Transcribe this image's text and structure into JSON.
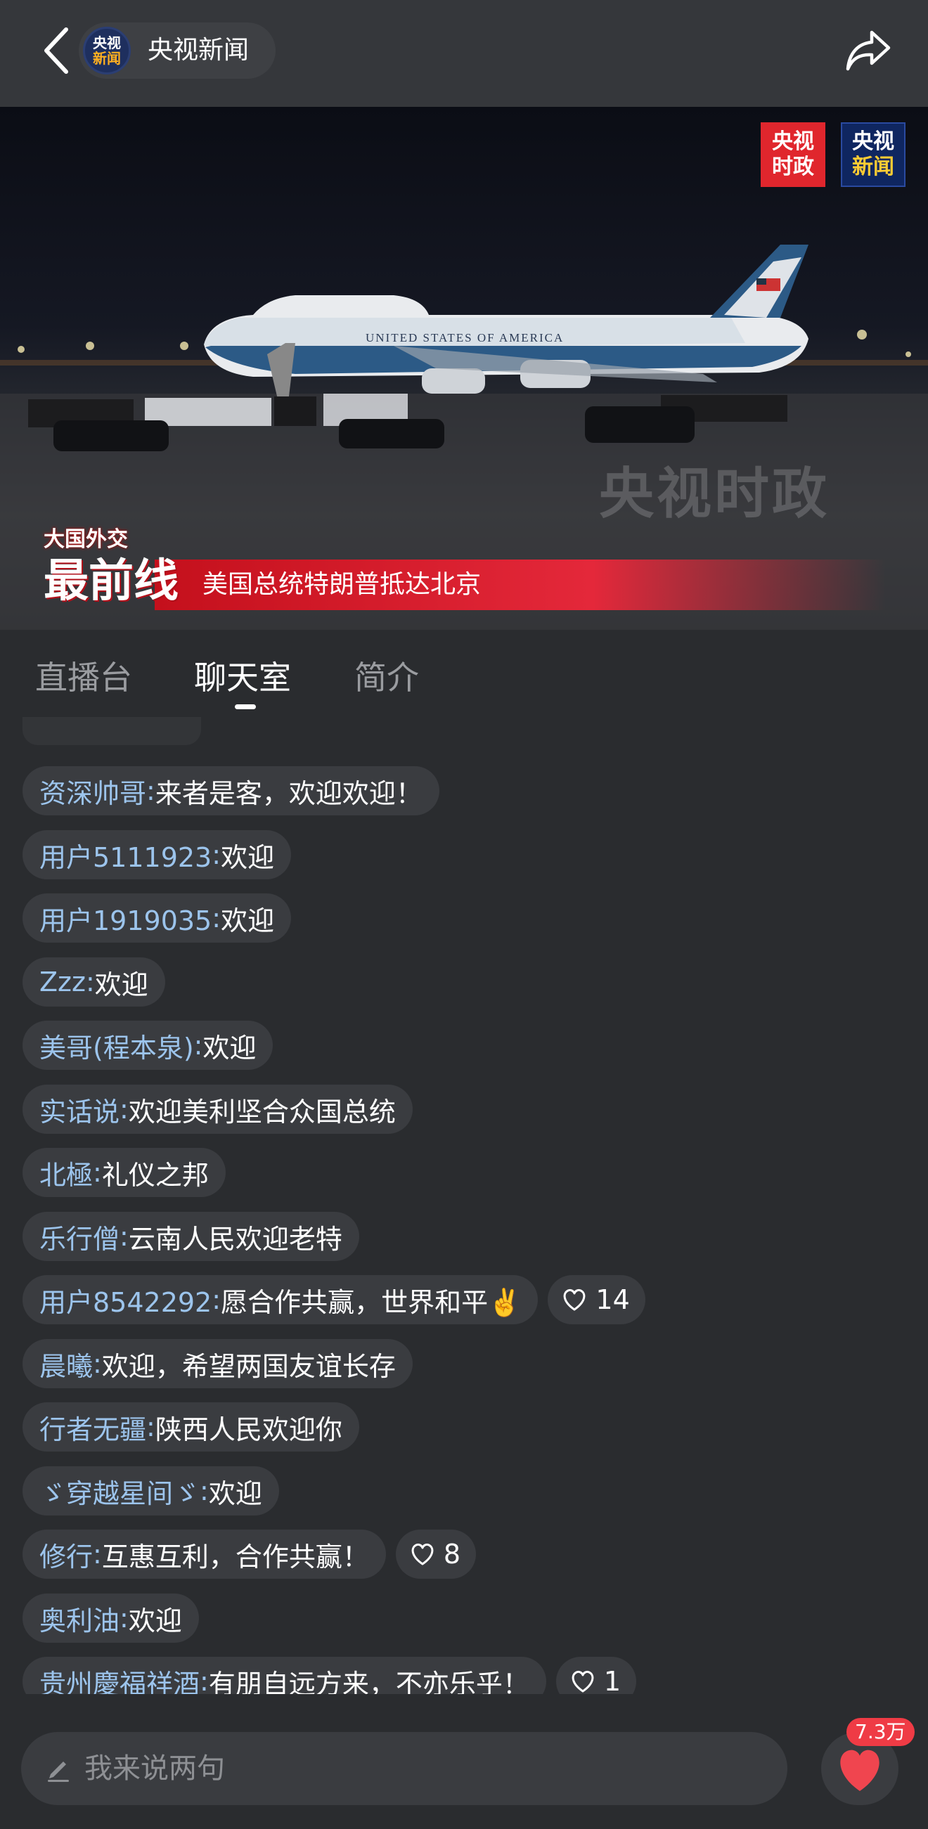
{
  "header": {
    "channel_logo_line1": "央视",
    "channel_logo_line2": "新闻",
    "channel_name": "央视新闻"
  },
  "video": {
    "badge_a_line1": "央视",
    "badge_a_line2": "时政",
    "badge_b_line1": "央视",
    "badge_b_line2": "新闻",
    "watermark": "央视时政",
    "plane_text": "UNITED STATES OF AMERICA",
    "program_top": "大国外交",
    "program_big": "最前线",
    "headline": "美国总统特朗普抵达北京"
  },
  "tabs": [
    {
      "label": "直播台",
      "active": false
    },
    {
      "label": "聊天室",
      "active": true
    },
    {
      "label": "简介",
      "active": false
    }
  ],
  "chat": {
    "messages": [
      {
        "user": "资深帅哥",
        "text": "来者是客，欢迎欢迎！"
      },
      {
        "user": "用户5111923",
        "text": "欢迎"
      },
      {
        "user": "用户1919035",
        "text": "欢迎"
      },
      {
        "user": "Zzz",
        "text": "欢迎"
      },
      {
        "user": "美哥(程本泉)",
        "text": "欢迎"
      },
      {
        "user": "实话说",
        "text": "欢迎美利坚合众国总统"
      },
      {
        "user": "北極",
        "text": "礼仪之邦"
      },
      {
        "user": "乐行僧",
        "text": "云南人民欢迎老特"
      },
      {
        "user": "用户8542292",
        "text": "愿合作共赢，世界和平✌️",
        "likes": "14"
      },
      {
        "user": "晨曦",
        "text": "欢迎，希望两国友谊长存"
      },
      {
        "user": "行者无疆",
        "text": "陕西人民欢迎你"
      },
      {
        "user": "ゞ穿越星间ゞ",
        "text": "欢迎"
      },
      {
        "user": "修行",
        "text": "互惠互利，合作共赢！",
        "likes": "8"
      },
      {
        "user": "奥利油",
        "text": "欢迎"
      },
      {
        "user": "贵州慶福祥酒",
        "text": "有朋自远方来，不亦乐乎！",
        "likes": "1"
      }
    ]
  },
  "input": {
    "placeholder": "我来说两句"
  },
  "like_button": {
    "count": "7.3万"
  },
  "colors": {
    "username": "#9cc4ec",
    "bubble": "#3a3c40",
    "like_badge": "#ef3b45",
    "heart": "#f0454f"
  }
}
